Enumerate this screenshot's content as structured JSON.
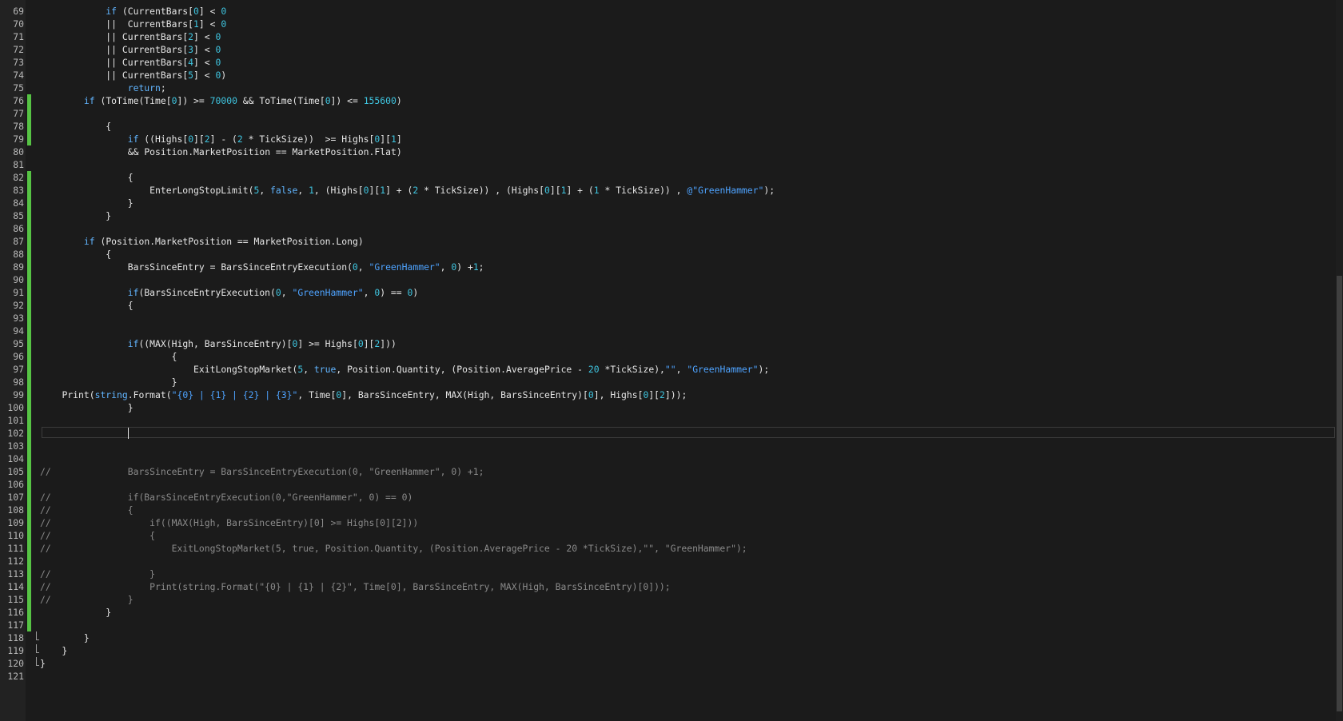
{
  "editor": {
    "lines": [
      {
        "n": "69",
        "text": "            if (CurrentBars[0] < 0",
        "changed": false
      },
      {
        "n": "70",
        "text": "            ||  CurrentBars[1] < 0",
        "changed": false
      },
      {
        "n": "71",
        "text": "            || CurrentBars[2] < 0",
        "changed": false
      },
      {
        "n": "72",
        "text": "            || CurrentBars[3] < 0",
        "changed": false
      },
      {
        "n": "73",
        "text": "            || CurrentBars[4] < 0",
        "changed": false
      },
      {
        "n": "74",
        "text": "            || CurrentBars[5] < 0)",
        "changed": false
      },
      {
        "n": "75",
        "text": "                return;",
        "changed": false
      },
      {
        "n": "76",
        "text": "        if (ToTime(Time[0]) >= 70000 && ToTime(Time[0]) <= 155600)",
        "changed": true
      },
      {
        "n": "77",
        "text": "",
        "changed": true
      },
      {
        "n": "78",
        "text": "            {",
        "changed": true
      },
      {
        "n": "79",
        "text": "                if ((Highs[0][2] - (2 * TickSize))  >= Highs[0][1]",
        "changed": true
      },
      {
        "n": "80",
        "text": "                && Position.MarketPosition == MarketPosition.Flat)",
        "changed": false
      },
      {
        "n": "81",
        "text": "",
        "changed": false
      },
      {
        "n": "82",
        "text": "                {",
        "changed": true
      },
      {
        "n": "83",
        "text": "                    EnterLongStopLimit(5, false, 1, (Highs[0][1] + (2 * TickSize)) , (Highs[0][1] + (1 * TickSize)) , @\"GreenHammer\");",
        "changed": true
      },
      {
        "n": "84",
        "text": "                }",
        "changed": true
      },
      {
        "n": "85",
        "text": "            }",
        "changed": true
      },
      {
        "n": "86",
        "text": "",
        "changed": true
      },
      {
        "n": "87",
        "text": "        if (Position.MarketPosition == MarketPosition.Long)",
        "changed": true
      },
      {
        "n": "88",
        "text": "            {",
        "changed": true
      },
      {
        "n": "89",
        "text": "                BarsSinceEntry = BarsSinceEntryExecution(0, \"GreenHammer\", 0) +1;",
        "changed": true
      },
      {
        "n": "90",
        "text": "",
        "changed": true
      },
      {
        "n": "91",
        "text": "                if(BarsSinceEntryExecution(0, \"GreenHammer\", 0) == 0)",
        "changed": true
      },
      {
        "n": "92",
        "text": "                {",
        "changed": true
      },
      {
        "n": "93",
        "text": "",
        "changed": true
      },
      {
        "n": "94",
        "text": "",
        "changed": true
      },
      {
        "n": "95",
        "text": "                if((MAX(High, BarsSinceEntry)[0] >= Highs[0][2]))",
        "changed": true
      },
      {
        "n": "96",
        "text": "                        {",
        "changed": true
      },
      {
        "n": "97",
        "text": "                            ExitLongStopMarket(5, true, Position.Quantity, (Position.AveragePrice - 20 *TickSize),\"\", \"GreenHammer\");",
        "changed": true
      },
      {
        "n": "98",
        "text": "                        }",
        "changed": true
      },
      {
        "n": "99",
        "text": "    Print(string.Format(\"{0} | {1} | {2} | {3}\", Time[0], BarsSinceEntry, MAX(High, BarsSinceEntry)[0], Highs[0][2]));",
        "changed": true
      },
      {
        "n": "100",
        "text": "                }",
        "changed": true
      },
      {
        "n": "101",
        "text": "",
        "changed": true
      },
      {
        "n": "102",
        "text": "",
        "changed": true
      },
      {
        "n": "103",
        "text": "",
        "changed": true
      },
      {
        "n": "104",
        "text": "",
        "changed": true
      },
      {
        "n": "105",
        "text": "//              BarsSinceEntry = BarsSinceEntryExecution(0, \"GreenHammer\", 0) +1;",
        "changed": true
      },
      {
        "n": "106",
        "text": "",
        "changed": true
      },
      {
        "n": "107",
        "text": "//              if(BarsSinceEntryExecution(0,\"GreenHammer\", 0) == 0)",
        "changed": true
      },
      {
        "n": "108",
        "text": "//              {",
        "changed": true
      },
      {
        "n": "109",
        "text": "//                  if((MAX(High, BarsSinceEntry)[0] >= Highs[0][2]))",
        "changed": true
      },
      {
        "n": "110",
        "text": "//                  {",
        "changed": true
      },
      {
        "n": "111",
        "text": "//                      ExitLongStopMarket(5, true, Position.Quantity, (Position.AveragePrice - 20 *TickSize),\"\", \"GreenHammer\");",
        "changed": true
      },
      {
        "n": "112",
        "text": "",
        "changed": true
      },
      {
        "n": "113",
        "text": "//                  }",
        "changed": true
      },
      {
        "n": "114",
        "text": "//                  Print(string.Format(\"{0} | {1} | {2}\", Time[0], BarsSinceEntry, MAX(High, BarsSinceEntry)[0]));",
        "changed": true
      },
      {
        "n": "115",
        "text": "//              }",
        "changed": true
      },
      {
        "n": "116",
        "text": "            }",
        "changed": true
      },
      {
        "n": "117",
        "text": "",
        "changed": true
      },
      {
        "n": "118",
        "text": "        }",
        "changed": false
      },
      {
        "n": "119",
        "text": "    }",
        "changed": false
      },
      {
        "n": "120",
        "text": "}",
        "changed": false
      },
      {
        "n": "121",
        "text": "",
        "changed": false
      }
    ],
    "current_line": "102",
    "fold_lines": [
      "118",
      "119",
      "120"
    ],
    "colors": {
      "background": "#1b1b1b",
      "change_bar": "#56c344",
      "keyword": "#61b5ff",
      "number": "#3fc5e0",
      "string": "#4ea3ff",
      "comment": "#8a8a8a"
    }
  }
}
